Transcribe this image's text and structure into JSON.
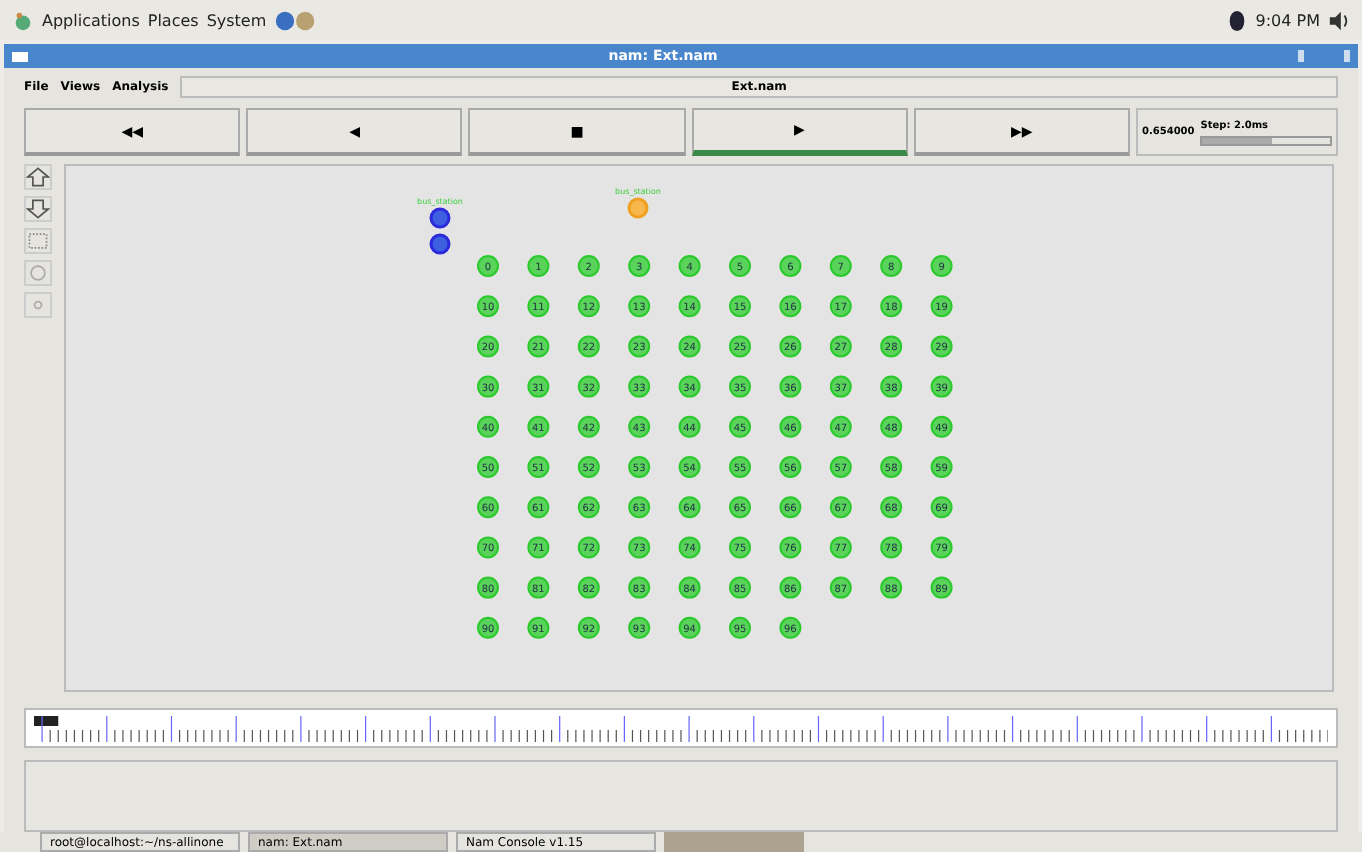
{
  "top_panel": {
    "menus": [
      "Applications",
      "Places",
      "System"
    ],
    "clock": "9:04 PM"
  },
  "window": {
    "title": "nam: Ext.nam"
  },
  "menu_bar": {
    "items": [
      "File",
      "Views",
      "Analysis"
    ],
    "file_name": "Ext.nam"
  },
  "controls": [
    {
      "glyph": "◀◀",
      "selected": false
    },
    {
      "glyph": "◀",
      "selected": false
    },
    {
      "glyph": "■",
      "selected": false
    },
    {
      "glyph": "▶",
      "selected": true
    },
    {
      "glyph": "▶▶",
      "selected": false
    }
  ],
  "time": "0.654000",
  "step": {
    "label": "Step: 2.0ms",
    "level": 0.55
  },
  "special_nodes": [
    {
      "kind": "blue",
      "label": "bus_station"
    },
    {
      "kind": "blue"
    },
    {
      "kind": "orange",
      "label": "bus_station"
    }
  ],
  "grid_nodes": [
    "0",
    "1",
    "2",
    "3",
    "4",
    "5",
    "6",
    "7",
    "8",
    "9",
    "10",
    "11",
    "12",
    "13",
    "14",
    "15",
    "16",
    "17",
    "18",
    "19",
    "20",
    "21",
    "22",
    "23",
    "24",
    "25",
    "26",
    "27",
    "28",
    "29",
    "30",
    "31",
    "32",
    "33",
    "34",
    "35",
    "36",
    "37",
    "38",
    "39",
    "40",
    "41",
    "42",
    "43",
    "44",
    "45",
    "46",
    "47",
    "48",
    "49",
    "50",
    "51",
    "52",
    "53",
    "54",
    "55",
    "56",
    "57",
    "58",
    "59",
    "60",
    "61",
    "62",
    "63",
    "64",
    "65",
    "66",
    "67",
    "68",
    "69",
    "70",
    "71",
    "72",
    "73",
    "74",
    "75",
    "76",
    "77",
    "78",
    "79",
    "80",
    "81",
    "82",
    "83",
    "84",
    "85",
    "86",
    "87",
    "88",
    "89",
    "90",
    "91",
    "92",
    "93",
    "94",
    "95",
    "96"
  ],
  "taskbar": [
    {
      "label": "root@localhost:~/ns-allinone",
      "selected": false
    },
    {
      "label": "nam: Ext.nam",
      "selected": true
    },
    {
      "label": "Nam Console v1.15",
      "selected": false
    }
  ]
}
